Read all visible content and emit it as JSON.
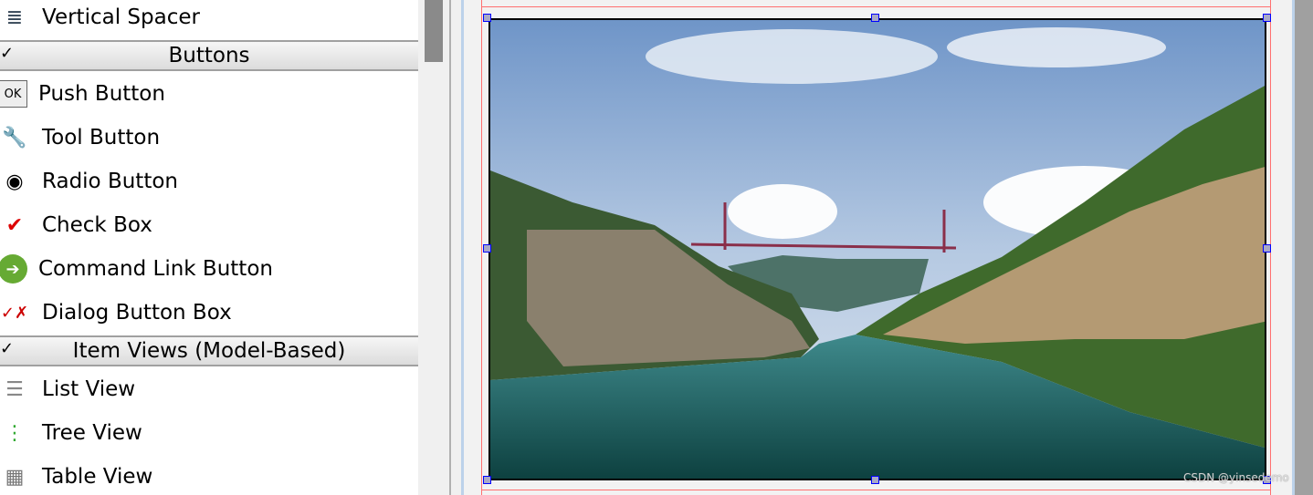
{
  "widget_box": {
    "items_top": [
      {
        "label": "Vertical Spacer",
        "icon": "vertical-spacer-icon"
      }
    ],
    "categories": [
      {
        "label": "Buttons",
        "items": [
          {
            "label": "Push Button",
            "icon": "push-button-icon",
            "glyph": "OK"
          },
          {
            "label": "Tool Button",
            "icon": "tool-button-icon",
            "glyph": "🔧"
          },
          {
            "label": "Radio Button",
            "icon": "radio-button-icon",
            "glyph": "◉"
          },
          {
            "label": "Check Box",
            "icon": "check-box-icon",
            "glyph": "✔"
          },
          {
            "label": "Command Link Button",
            "icon": "command-link-icon",
            "glyph": "➔"
          },
          {
            "label": "Dialog Button Box",
            "icon": "dialog-button-box-icon",
            "glyph": "✓✗"
          }
        ]
      },
      {
        "label": "Item Views (Model-Based)",
        "items": [
          {
            "label": "List View",
            "icon": "list-view-icon",
            "glyph": "☰"
          },
          {
            "label": "Tree View",
            "icon": "tree-view-icon",
            "glyph": "⋮"
          },
          {
            "label": "Table View",
            "icon": "table-view-icon",
            "glyph": "▦"
          }
        ]
      }
    ]
  },
  "form": {
    "watermark": "CSDN @yinsedemo",
    "selection_color": "#0000ff",
    "layout_color": "#ff7070"
  }
}
